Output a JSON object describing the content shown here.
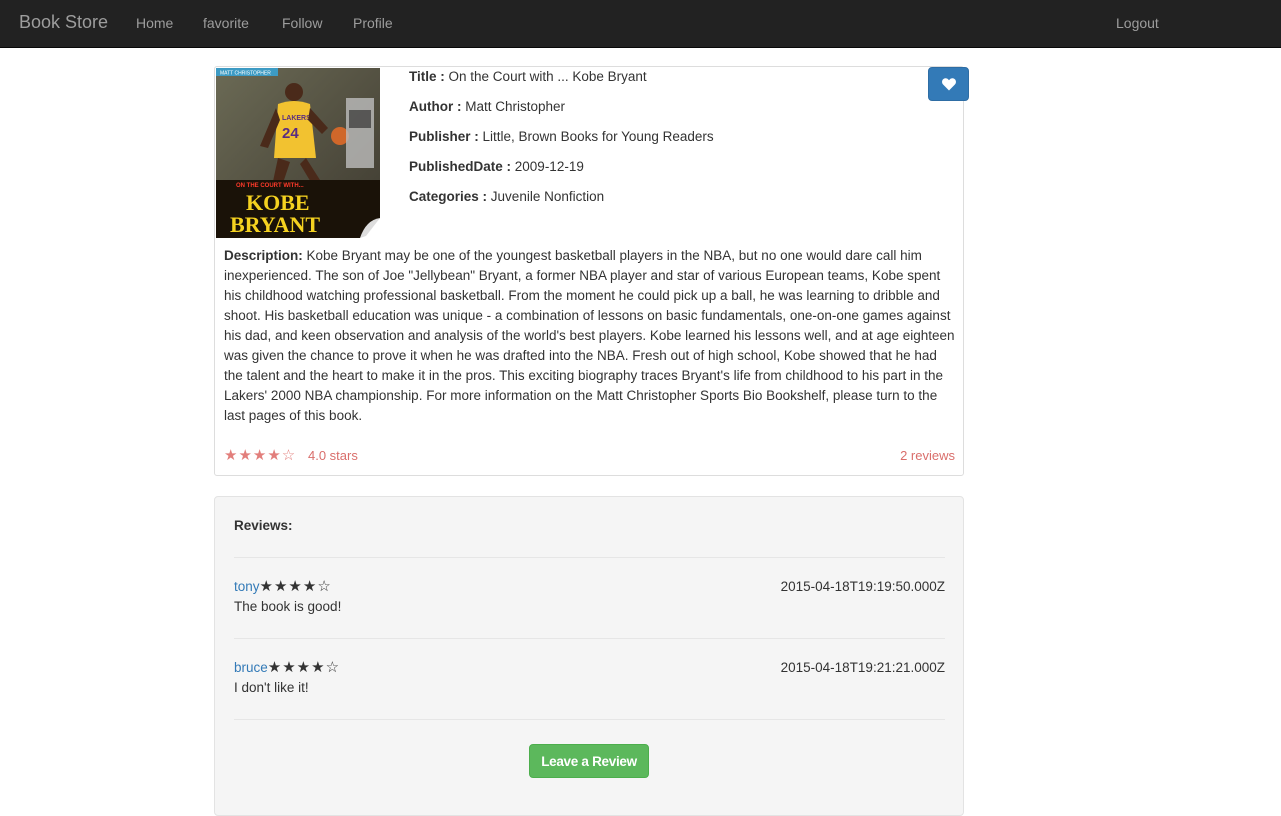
{
  "navbar": {
    "brand": "Book Store",
    "links": [
      "Home",
      "favorite",
      "Follow",
      "Profile"
    ],
    "logout": "Logout"
  },
  "book": {
    "cover": {
      "publisher_tag": "MATT CHRISTOPHER",
      "subtitle": "ON THE COURT WITH...",
      "title_line1": "KOBE",
      "title_line2": "BRYANT",
      "jersey_team": "LAKERS",
      "jersey_number": "24"
    },
    "fields": {
      "title_label": "Title :",
      "title_value": "On the Court with ... Kobe Bryant",
      "author_label": "Author :",
      "author_value": "Matt Christopher",
      "publisher_label": "Publisher :",
      "publisher_value": "Little, Brown Books for Young Readers",
      "date_label": "PublishedDate :",
      "date_value": "2009-12-19",
      "categories_label": "Categories :",
      "categories_value": "Juvenile Nonfiction"
    },
    "description_label": "Description:",
    "description": "Kobe Bryant may be one of the youngest basketball players in the NBA, but no one would dare call him inexperienced. The son of Joe \"Jellybean\" Bryant, a former NBA player and star of various European teams, Kobe spent his childhood watching professional basketball. From the moment he could pick up a ball, he was learning to dribble and shoot. His basketball education was unique - a combination of lessons on basic fundamentals, one-on-one games against his dad, and keen observation and analysis of the world's best players. Kobe learned his lessons well, and at age eighteen was given the chance to prove it when he was drafted into the NBA. Fresh out of high school, Kobe showed that he had the talent and the heart to make it in the pros. This exciting biography traces Bryant's life from childhood to his part in the Lakers' 2000 NBA championship. For more information on the Matt Christopher Sports Bio Bookshelf, please turn to the last pages of this book.",
    "rating": {
      "stars": "★★★★☆",
      "stars_value": 4,
      "stars_max": 5,
      "text": "4.0 stars"
    },
    "reviews_count": "2 reviews",
    "favorite_icon": "heart-icon"
  },
  "reviews": {
    "heading": "Reviews:",
    "items": [
      {
        "user": "tony",
        "stars": "★★★★☆",
        "rating": 4,
        "date": "2015-04-18T19:19:50.000Z",
        "text": "The book is good!"
      },
      {
        "user": "bruce",
        "stars": "★★★★☆",
        "rating": 4,
        "date": "2015-04-18T19:21:21.000Z",
        "text": "I don't like it!"
      }
    ],
    "leave_button": "Leave a Review"
  },
  "colors": {
    "navbar_bg": "#222222",
    "nav_text": "#9d9d9d",
    "primary": "#337ab7",
    "success": "#5cb85c",
    "rating": "#d9534f"
  }
}
